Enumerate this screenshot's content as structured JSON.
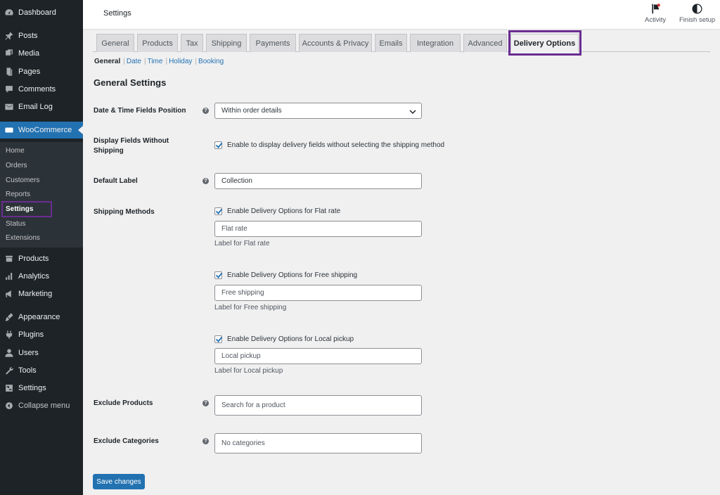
{
  "sidebar": {
    "items": [
      {
        "label": "Dashboard",
        "icon": "dashboard-icon"
      },
      {
        "label": "Posts",
        "icon": "pin-icon"
      },
      {
        "label": "Media",
        "icon": "media-icon"
      },
      {
        "label": "Pages",
        "icon": "page-icon"
      },
      {
        "label": "Comments",
        "icon": "comment-icon"
      },
      {
        "label": "Email Log",
        "icon": "email-icon"
      },
      {
        "label": "WooCommerce",
        "icon": "woocommerce-icon"
      },
      {
        "label": "Products",
        "icon": "products-icon"
      },
      {
        "label": "Analytics",
        "icon": "analytics-icon"
      },
      {
        "label": "Marketing",
        "icon": "megaphone-icon"
      },
      {
        "label": "Appearance",
        "icon": "brush-icon"
      },
      {
        "label": "Plugins",
        "icon": "plugin-icon"
      },
      {
        "label": "Users",
        "icon": "user-icon"
      },
      {
        "label": "Tools",
        "icon": "wrench-icon"
      },
      {
        "label": "Settings",
        "icon": "settings-icon"
      },
      {
        "label": "Collapse menu",
        "icon": "collapse-icon"
      }
    ],
    "woo_submenu": [
      "Home",
      "Orders",
      "Customers",
      "Reports",
      "Settings",
      "Status",
      "Extensions"
    ]
  },
  "header": {
    "title": "Settings",
    "activity_label": "Activity",
    "finish_setup_label": "Finish setup"
  },
  "tabs": [
    "General",
    "Products",
    "Tax",
    "Shipping",
    "Payments",
    "Accounts & Privacy",
    "Emails",
    "Integration",
    "Advanced",
    "Delivery Options"
  ],
  "subnav": [
    "General",
    "Date",
    "Time",
    "Holiday",
    "Booking"
  ],
  "section_title": "General Settings",
  "form": {
    "position_label": "Date & Time Fields Position",
    "position_value": "Within order details",
    "display_without_label_1": "Display Fields Without",
    "display_without_label_2": "Shipping",
    "display_without_checkbox": "Enable to display delivery fields without selecting the shipping method",
    "default_label_label": "Default Label",
    "default_label_value": "Collection",
    "shipping_methods_label": "Shipping Methods",
    "methods": [
      {
        "checkbox": "Enable Delivery Options for Flat rate",
        "value": "Flat rate",
        "desc": "Label for Flat rate"
      },
      {
        "checkbox": "Enable Delivery Options for Free shipping",
        "value": "Free shipping",
        "desc": "Label for Free shipping"
      },
      {
        "checkbox": "Enable Delivery Options for Local pickup",
        "value": "Local pickup",
        "desc": "Label for Local pickup"
      }
    ],
    "exclude_products_label": "Exclude Products",
    "exclude_products_placeholder": "Search for a product",
    "exclude_categories_label": "Exclude Categories",
    "exclude_categories_placeholder": "No categories",
    "help_glyph": "?",
    "save_label": "Save changes"
  },
  "colors": {
    "accent": "#2271b1",
    "highlight": "#6a2c91",
    "sidebar_bg": "#1d2327"
  }
}
